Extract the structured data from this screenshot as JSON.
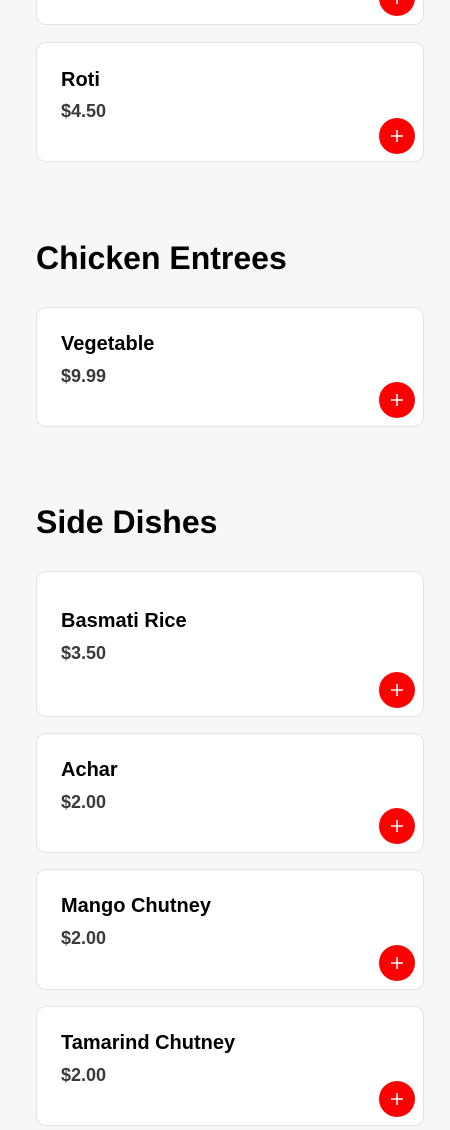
{
  "accent_color": "#ff0000",
  "add_button_icon": "plus-icon",
  "top_partial_item": {},
  "bread": {
    "items": [
      {
        "name": "Roti",
        "price": "$4.50"
      }
    ]
  },
  "chicken_entrees": {
    "title": "Chicken Entrees",
    "items": [
      {
        "name": "Vegetable",
        "price": "$9.99"
      }
    ]
  },
  "side_dishes": {
    "title": "Side Dishes",
    "items": [
      {
        "name": "Basmati Rice",
        "price": "$3.50"
      },
      {
        "name": "Achar",
        "price": "$2.00"
      },
      {
        "name": "Mango Chutney",
        "price": "$2.00"
      },
      {
        "name": "Tamarind Chutney",
        "price": "$2.00"
      }
    ]
  }
}
